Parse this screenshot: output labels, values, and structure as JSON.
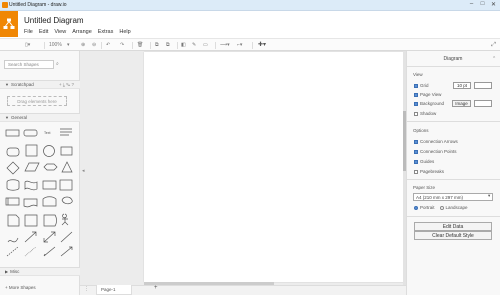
{
  "window": {
    "title": "Untitled Diagram - draw.io",
    "controls": [
      "–",
      "□",
      "✕"
    ]
  },
  "app": {
    "doc_title": "Untitled Diagram",
    "brand_color": "#f08705"
  },
  "menu": [
    "File",
    "Edit",
    "View",
    "Arrange",
    "Extras",
    "Help"
  ],
  "toolbar": {
    "zoom": "100%"
  },
  "sidebar": {
    "search_placeholder": "Search Shapes",
    "scratchpad_title": "Scratchpad",
    "scratchpad_hint": "Drag elements here",
    "general_title": "General",
    "misc_title": "Misc",
    "advanced_title": "Advanced",
    "more_shapes": "+ More Shapes"
  },
  "page": {
    "tab": "Page-1"
  },
  "panel": {
    "tab": "Diagram",
    "view_title": "View",
    "grid_label": "Grid",
    "grid_size": "10 pt",
    "page_view_label": "Page View",
    "background_label": "Background",
    "background_btn": "Image",
    "shadow_label": "Shadow",
    "options_title": "Options",
    "opt_conn_arrows": "Connection Arrows",
    "opt_conn_points": "Connection Points",
    "opt_guides": "Guides",
    "opt_pagebreaks": "Pagebreaks",
    "paper_title": "Paper Size",
    "paper_value": "A4 (210 mm x 297 mm)",
    "portrait": "Portrait",
    "landscape": "Landscape",
    "edit_data_btn": "Edit Data",
    "clear_style_btn": "Clear Default Style"
  }
}
